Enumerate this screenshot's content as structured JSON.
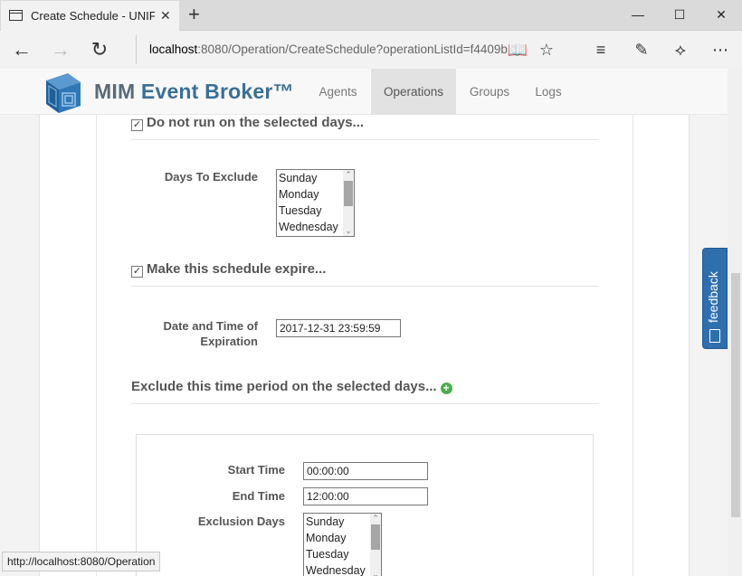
{
  "browser": {
    "tab_title": "Create Schedule - UNIF",
    "url_host": "localhost",
    "url_rest": ":8080/Operation/CreateSchedule?operationListId=f4409b",
    "status_url": "http://localhost:8080/Operation"
  },
  "site": {
    "brand_mim": "MIM",
    "brand_rest": "Event Broker™",
    "nav": [
      {
        "label": "Agents",
        "active": false
      },
      {
        "label": "Operations",
        "active": true
      },
      {
        "label": "Groups",
        "active": false
      },
      {
        "label": "Logs",
        "active": false
      }
    ]
  },
  "form": {
    "exclude_days_section": {
      "checked": true,
      "title": "Do not run on the selected days...",
      "label": "Days To Exclude",
      "options": [
        "Sunday",
        "Monday",
        "Tuesday",
        "Wednesday"
      ]
    },
    "expire_section": {
      "checked": true,
      "title": "Make this schedule expire...",
      "label_line1": "Date and Time of",
      "label_line2": "Expiration",
      "value": "2017-12-31 23:59:59"
    },
    "exclude_period_section": {
      "title": "Exclude this time period on the selected days...",
      "start_time_label": "Start Time",
      "start_time_value": "00:00:00",
      "end_time_label": "End Time",
      "end_time_value": "12:00:00",
      "days_label": "Exclusion Days",
      "days_options": [
        "Sunday",
        "Monday",
        "Tuesday",
        "Wednesday"
      ]
    }
  },
  "feedback_label": "feedback",
  "colors": {
    "brand_blue": "#3a6f97",
    "feedback_bg": "#2f6fad",
    "add_icon": "#4cae4c"
  }
}
